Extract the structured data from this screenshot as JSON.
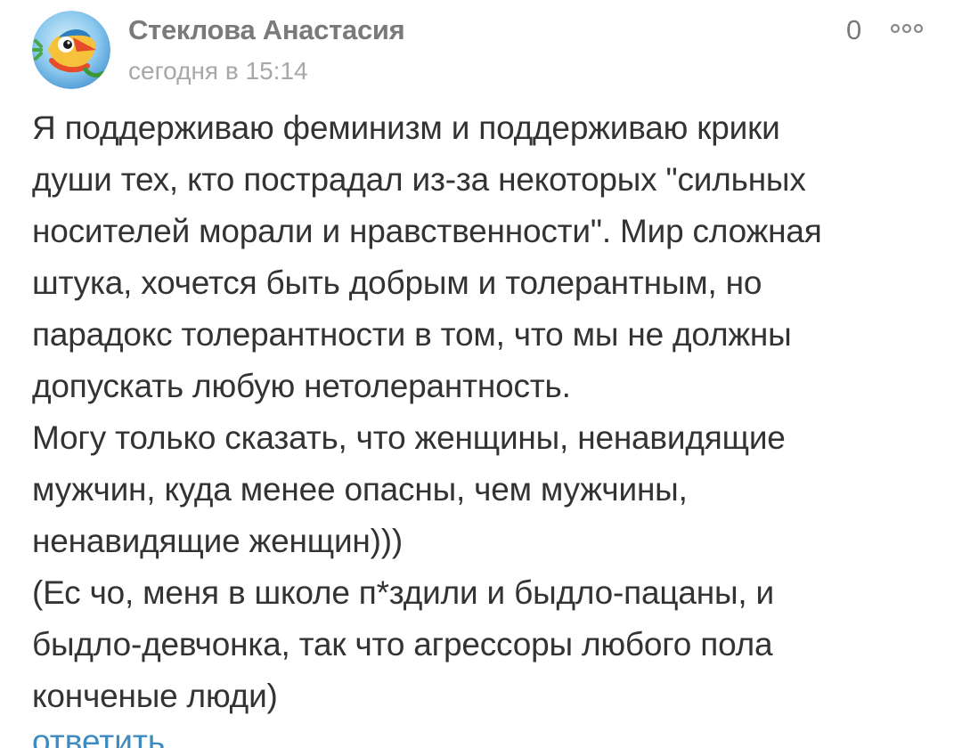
{
  "comment": {
    "author": "Стеклова Анастасия",
    "timestamp": "сегодня в 15:14",
    "likes": "0",
    "more_icon": "more-dots-icon",
    "avatar_icon": "cartoon-fish-avatar",
    "lines": [
      "Я поддерживаю феминизм и поддерживаю крики",
      "души тех, кто пострадал из-за некоторых \"сильных",
      "носителей морали и нравственности\". Мир сложная",
      "штука, хочется быть добрым и толерантным, но",
      "парадокс толерантности в том, что мы не должны",
      "допускать любую нетолерантность.",
      "Могу только сказать, что женщины, ненавидящие",
      "мужчин, куда менее опасны, чем мужчины,",
      "ненавидящие женщин)))",
      "(Ес чо, меня в школе п*здили и быдло-пацаны, и",
      "быдло-девчонка, так что агрессоры любого пола",
      "конченые люди)"
    ],
    "reply_label": "ответить"
  },
  "colors": {
    "author": "#7a7a7a",
    "timestamp": "#a8a8a8",
    "text": "#333333",
    "link": "#3d8ac0"
  }
}
